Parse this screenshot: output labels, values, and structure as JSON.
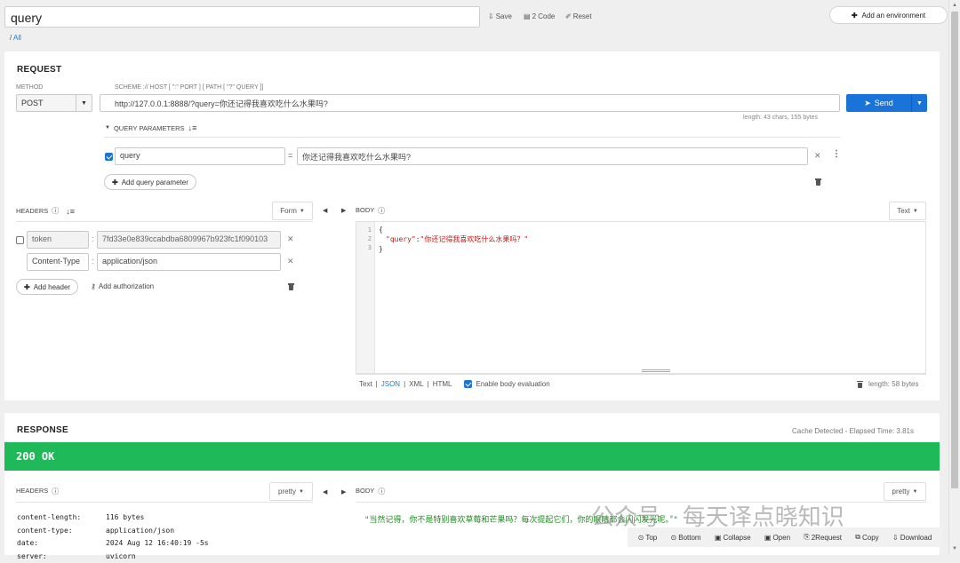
{
  "top": {
    "request_name": "query",
    "save": "Save",
    "code": "2 Code",
    "reset": "Reset",
    "add_environment": "Add an environment",
    "breadcrumb_sep": "/",
    "breadcrumb_all": "All"
  },
  "request": {
    "title": "REQUEST",
    "method_label": "METHOD",
    "method": "POST",
    "url_label": "SCHEME :// HOST [ \":\" PORT ] [ PATH [ \"?\" QUERY ]]",
    "url": "http://127.0.0.1:8888/?query=你还记得我喜欢吃什么水果吗?",
    "send": "Send",
    "length_info": "length: 43 chars, 155 bytes",
    "query_params_label": "QUERY PARAMETERS",
    "query_param": {
      "key": "query",
      "eq": "=",
      "value": "你还记得我喜欢吃什么水果吗?"
    },
    "add_query_param": "Add query parameter"
  },
  "headers": {
    "label": "HEADERS",
    "form": "Form",
    "rows": [
      {
        "key": "token",
        "value": "7fd33e0e839ccabdba6809967b923fc1f090103",
        "checked": false
      },
      {
        "key": "Content-Type",
        "value": "application/json",
        "checked": true
      }
    ],
    "add_header": "Add header",
    "add_authorization": "Add authorization"
  },
  "body": {
    "label": "BODY",
    "type": "Text",
    "line_numbers": [
      "1",
      "2",
      "3"
    ],
    "line1": "{",
    "line2_key": "\"query\"",
    "line2_colon": ":",
    "line2_value": "\"你还记得我喜欢吃什么水果吗？\"",
    "line3": "}",
    "formats": {
      "text": "Text",
      "json": "JSON",
      "xml": "XML",
      "html": "HTML",
      "sep": "|"
    },
    "enable_eval": "Enable body evaluation",
    "length": "length: 58 bytes"
  },
  "response": {
    "title": "RESPONSE",
    "cache": "Cache Detected - Elapsed Time: 3.81s",
    "status": "200 OK",
    "headers_label": "HEADERS",
    "pretty": "pretty",
    "body_label": "BODY",
    "pretty2": "pretty",
    "header_rows": [
      {
        "key": "content-length:",
        "value": "116 bytes"
      },
      {
        "key": "content-type:",
        "value": "application/json"
      },
      {
        "key": "date:",
        "value": "2024 Aug 12 16:40:19 -5s"
      },
      {
        "key": "server:",
        "value": "uvicorn"
      }
    ],
    "body_text": "\"当然记得，你不是特别喜欢草莓和芒果吗？每次提起它们，你的眼睛都会闪闪发光呢。\"",
    "footer": {
      "top": "Top",
      "bottom": "Bottom",
      "collapse": "Collapse",
      "open": "Open",
      "request": "2Request",
      "copy": "Copy",
      "download": "Download"
    }
  },
  "watermark": "公众号 · 每天译点晓知识",
  "colors": {
    "accent": "#1a73d9",
    "status_green": "#1fb95a",
    "json_key": "#c41a16",
    "json_value": "#c41a16",
    "response_text": "#1e8a1e"
  }
}
